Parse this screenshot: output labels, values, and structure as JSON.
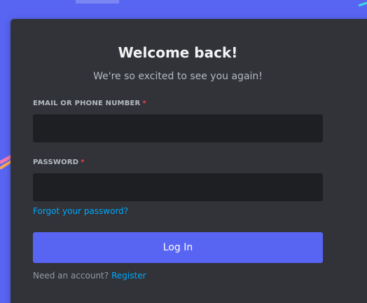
{
  "colors": {
    "background": "#5865f2",
    "card": "#313338",
    "input": "#1e1f22",
    "accent": "#5865f2",
    "link": "#00a8fc",
    "required": "#f23f42"
  },
  "login": {
    "title": "Welcome back!",
    "subtitle": "We're so excited to see you again!",
    "email_label": "EMAIL OR PHONE NUMBER",
    "email_value": "",
    "password_label": "PASSWORD",
    "password_value": "",
    "required_mark": "*",
    "forgot_link": "Forgot your password?",
    "login_button": "Log In",
    "need_account": "Need an account?",
    "register_link": "Register"
  }
}
